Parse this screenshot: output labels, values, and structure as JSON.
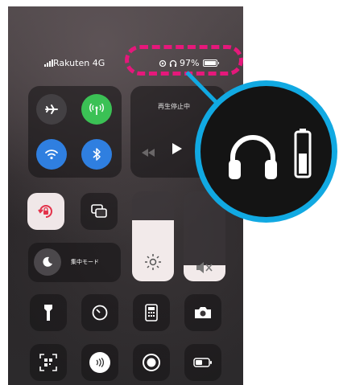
{
  "status_bar": {
    "carrier": "Rakuten 4G",
    "battery_text": "97%"
  },
  "media": {
    "label": "再生停止中"
  },
  "focus": {
    "label": "集中モード"
  },
  "sliders": {
    "brightness_level": 0.68,
    "volume_level": 0.18
  },
  "colors": {
    "accent_blue": "#2f7fe0",
    "accent_green": "#3bc155",
    "annotation_pink": "#e5187b",
    "annotation_blue": "#11a9e2",
    "rotation_lock_red": "#e3324a"
  }
}
